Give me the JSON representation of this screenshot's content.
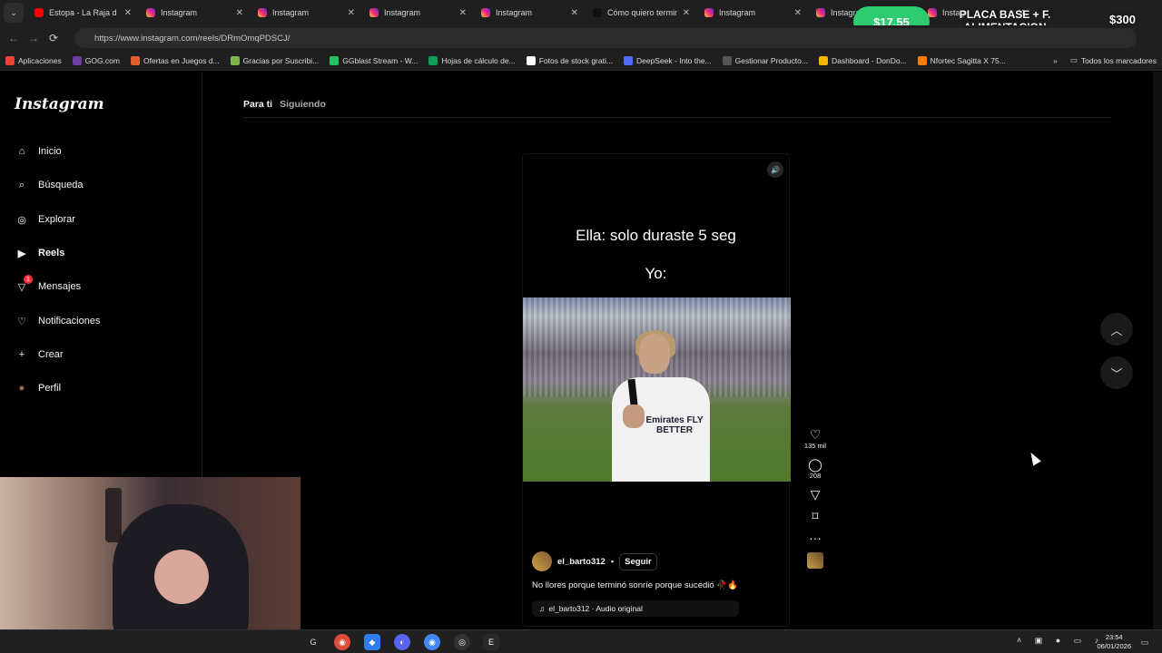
{
  "browser": {
    "tabs": [
      {
        "label": "Estopa - La Raja d",
        "icon": "youtube-icon"
      },
      {
        "label": "Instagram",
        "icon": "instagram-icon"
      },
      {
        "label": "Instagram",
        "icon": "instagram-icon"
      },
      {
        "label": "Instagram",
        "icon": "instagram-icon"
      },
      {
        "label": "Instagram",
        "icon": "instagram-icon"
      },
      {
        "label": "Cómo quiero termin",
        "icon": "tiktok-icon"
      },
      {
        "label": "Instagram",
        "icon": "instagram-icon"
      },
      {
        "label": "Instagram",
        "icon": "instagram-icon"
      },
      {
        "label": "Instag",
        "icon": "instagram-icon"
      }
    ],
    "url": "https://www.instagram.com/reels/DRmOmqPDSCJ/",
    "bookmarks": [
      {
        "label": "Aplicaciones",
        "color": "#ea4335"
      },
      {
        "label": "GOG.com",
        "color": "#6b3fa0"
      },
      {
        "label": "Ofertas en Juegos d...",
        "color": "#e35d2f"
      },
      {
        "label": "Gracias por Suscribi...",
        "color": "#7ab648"
      },
      {
        "label": "GGblast Stream - W...",
        "color": "#24c160"
      },
      {
        "label": "Hojas de cálculo de...",
        "color": "#0f9d58"
      },
      {
        "label": "Fotos de stock grati...",
        "color": "#ffffff"
      },
      {
        "label": "DeepSeek - Into the...",
        "color": "#4d6bfe"
      },
      {
        "label": "Gestionar Producto...",
        "color": "#555555"
      },
      {
        "label": "Dashboard - DonDo...",
        "color": "#f4b400"
      },
      {
        "label": "Nfortec Sagitta X 75...",
        "color": "#f57c00"
      }
    ],
    "all_bookmarks": "Todos los marcadores"
  },
  "stream_overlay": {
    "price": "$17,55",
    "title": "PLACA BASE + F. ALIMENTACION",
    "goal": "$300"
  },
  "sidebar": {
    "logo": "Instagram",
    "items": [
      {
        "label": "Inicio",
        "icon": "home-icon"
      },
      {
        "label": "Búsqueda",
        "icon": "search-icon"
      },
      {
        "label": "Explorar",
        "icon": "compass-icon"
      },
      {
        "label": "Reels",
        "icon": "reels-icon"
      },
      {
        "label": "Mensajes",
        "icon": "messages-icon"
      },
      {
        "label": "Notificaciones",
        "icon": "heart-icon"
      },
      {
        "label": "Crear",
        "icon": "plus-icon"
      },
      {
        "label": "Perfil",
        "icon": "avatar-icon"
      }
    ],
    "messages_badge": "1"
  },
  "feed_tabs": {
    "for_you": "Para ti",
    "following": "Siguiendo"
  },
  "reel": {
    "caption_line1": "Ella: solo duraste 5 seg",
    "caption_line2": "Yo:",
    "video_text": "Emirates FLY BETTER",
    "username": "el_barto312",
    "follow_label": "Seguir",
    "description": "No llores porque terminó sonríe porque sucedió 🥀🔥",
    "audio": "el_barto312 · Audio original",
    "likes": "135 mil",
    "comments": "208"
  },
  "taskbar": {
    "time": "23:54",
    "date": "06/01/2026"
  }
}
